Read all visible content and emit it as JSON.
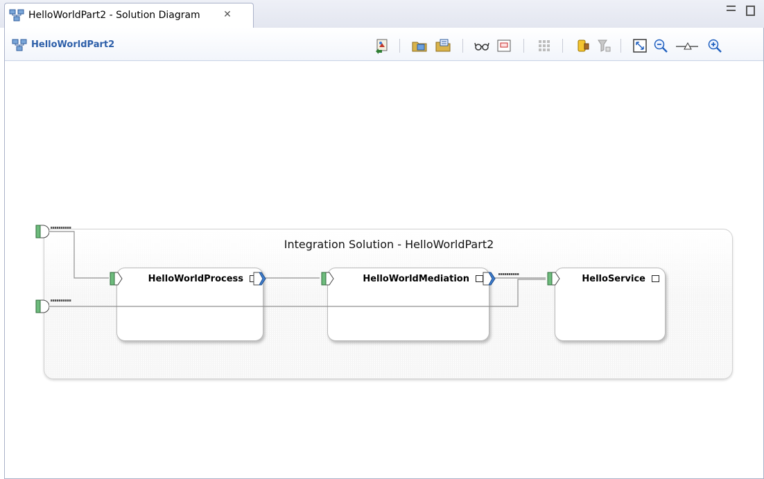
{
  "tab": {
    "title": "HelloWorldPart2 - Solution Diagram",
    "close_symbol": "✕",
    "icon": "solution-diagram-icon"
  },
  "header": {
    "title": "HelloWorldPart2",
    "icon": "solution-diagram-icon"
  },
  "toolbar": [
    "export-image-icon",
    "open-folder-icon",
    "open-file-icon",
    "glasses-icon",
    "frame-icon",
    "grid-icon",
    "highlight-icon",
    "filter-icon",
    "fit-to-window-icon",
    "zoom-out-icon",
    "zoom-slider-icon",
    "zoom-in-icon"
  ],
  "diagram": {
    "solution_title": "Integration Solution - HelloWorldPart2",
    "components": [
      {
        "name": "HelloWorldProcess"
      },
      {
        "name": "HelloWorldMediation"
      },
      {
        "name": "HelloService"
      }
    ]
  },
  "colors": {
    "header_title": "#2c5ea8",
    "interface_green": "#6dbb7c",
    "reference_blue": "#3f7fd0"
  }
}
